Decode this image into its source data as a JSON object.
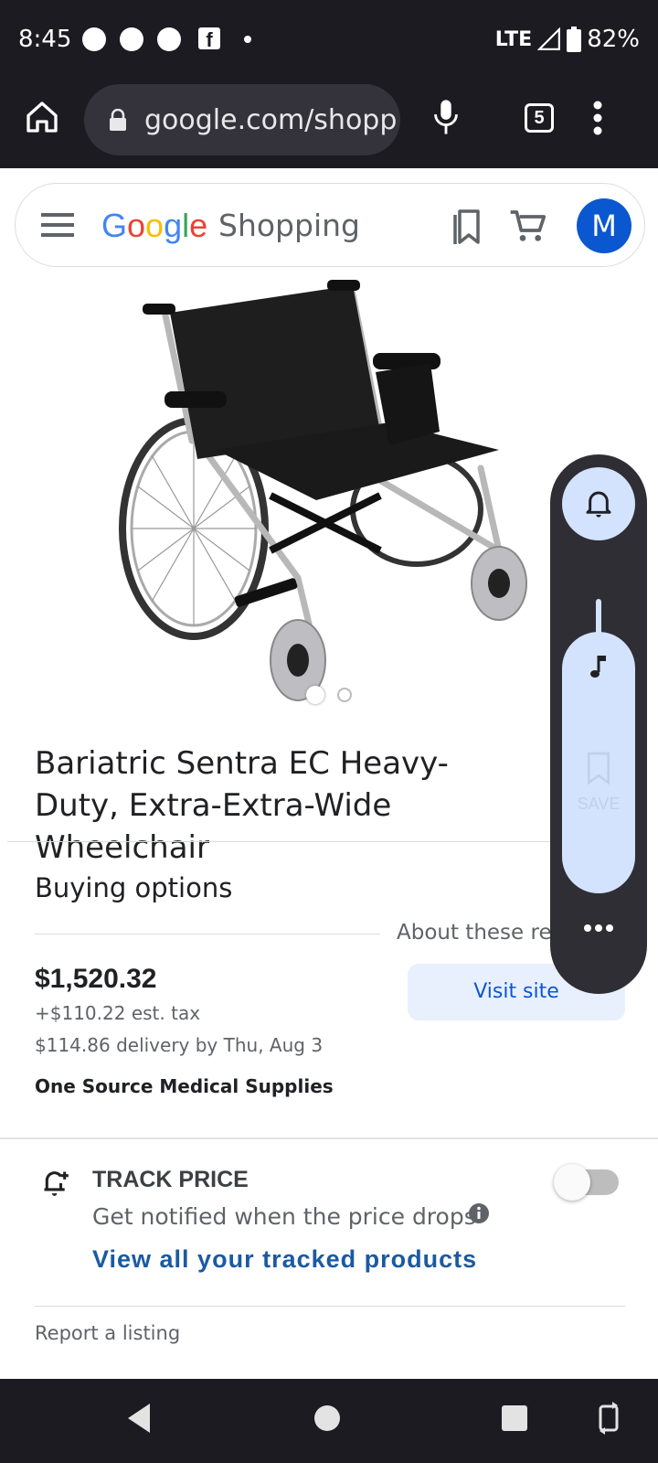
{
  "status_bar": {
    "time": "8:45",
    "network": "LTE",
    "battery": "82%"
  },
  "browser": {
    "url": "google.com/shopp",
    "tab_count": "5"
  },
  "header": {
    "logo_letters": [
      "G",
      "o",
      "o",
      "g",
      "l",
      "e"
    ],
    "logo_colors": [
      "#4285F4",
      "#EA4335",
      "#FBBC05",
      "#4285F4",
      "#34A853",
      "#EA4335"
    ],
    "service": "Shopping",
    "avatar_initial": "M"
  },
  "product": {
    "title": "Bariatric Sentra EC Heavy-Duty, Extra-Extra-Wide Wheelchair",
    "image_pages": 2,
    "image_active_page": 1
  },
  "buying_options": {
    "heading": "Buying options",
    "about": "About these results",
    "price": "$1,520.32",
    "tax": "+$110.22 est. tax",
    "delivery": "$114.86 delivery by Thu, Aug 3",
    "seller": "One Source Medical Supplies",
    "visit_label": "Visit site"
  },
  "track_price": {
    "title": "TRACK PRICE",
    "description": "Get notified when the price drops",
    "link": "View all your tracked products",
    "enabled": false
  },
  "footer": {
    "report": "Report a listing"
  },
  "volume_panel": {
    "save_label": "SAVE",
    "level": 0.6
  },
  "colors": {
    "accent": "#0b57d0",
    "link": "#1a5aa3",
    "dark_bar": "#1c1b22"
  }
}
